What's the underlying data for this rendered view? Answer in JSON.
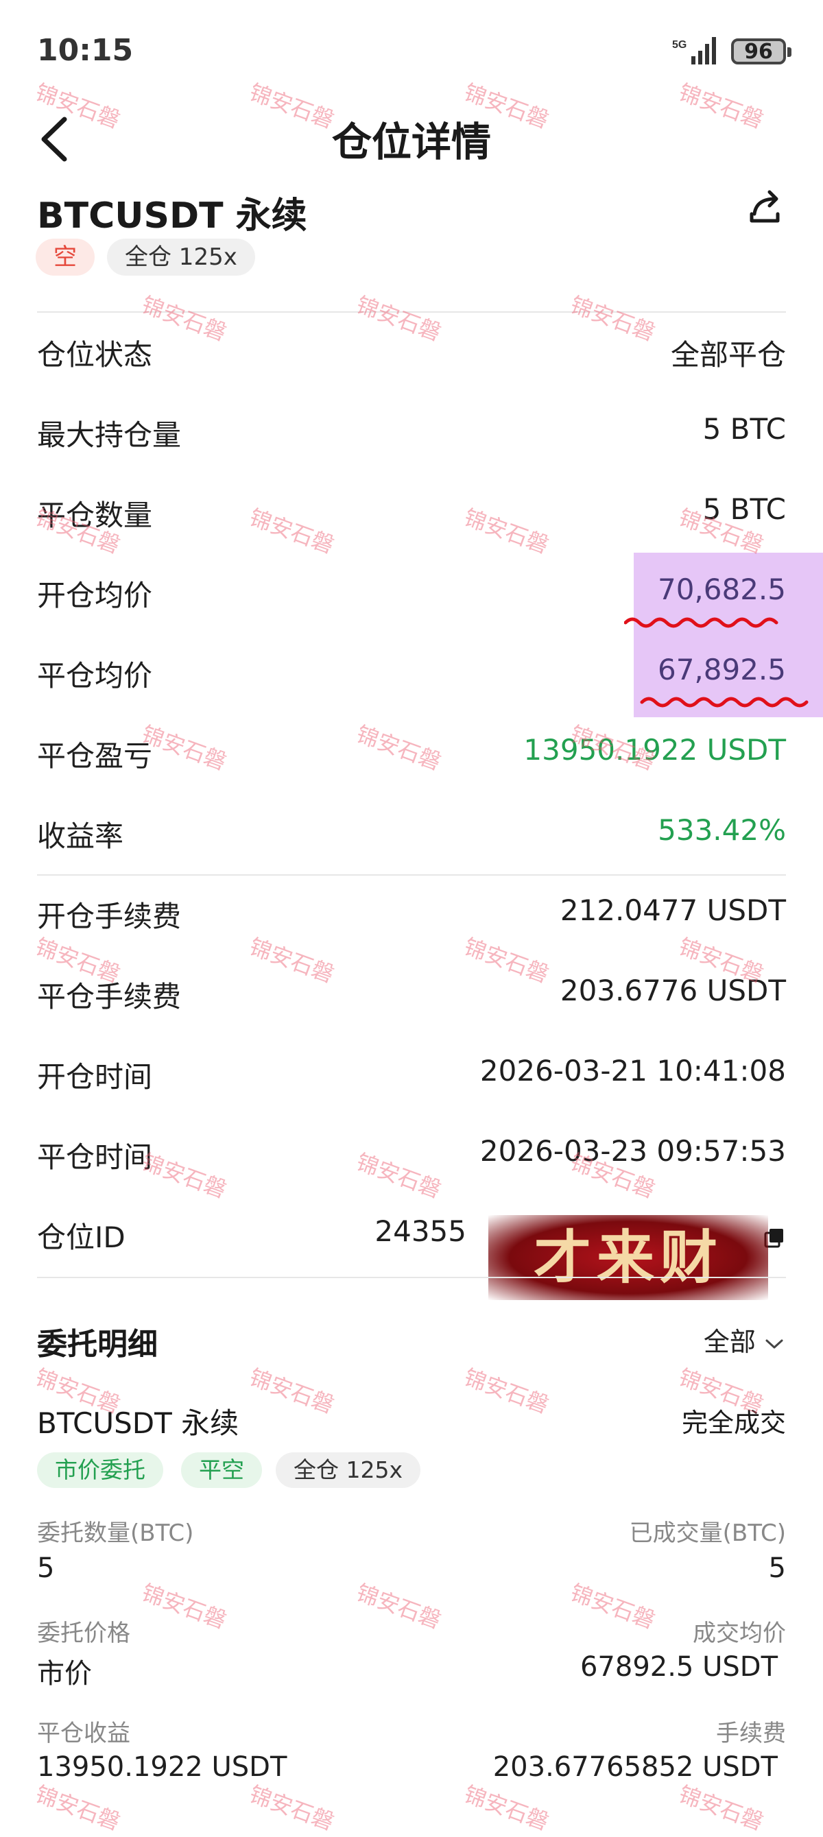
{
  "status_bar": {
    "time": "10:15",
    "network": "5G",
    "battery": "96"
  },
  "header": {
    "title": "仓位详情"
  },
  "position": {
    "symbol": "BTCUSDT 永续",
    "side_tag": "空",
    "margin_tag": "全仓 125x",
    "rows_a": [
      {
        "label": "仓位状态",
        "value": "全部平仓"
      },
      {
        "label": "最大持仓量",
        "value": "5 BTC"
      },
      {
        "label": "平仓数量",
        "value": "5 BTC"
      },
      {
        "label": "开仓均价",
        "value": "70,682.5"
      },
      {
        "label": "平仓均价",
        "value": "67,892.5"
      },
      {
        "label": "平仓盈亏",
        "value": "13950.1922 USDT"
      },
      {
        "label": "收益率",
        "value": "533.42%"
      }
    ],
    "rows_b": [
      {
        "label": "开仓手续费",
        "value": "212.0477 USDT"
      },
      {
        "label": "平仓手续费",
        "value": "203.6776 USDT"
      },
      {
        "label": "开仓时间",
        "value": "2026-03-21 10:41:08"
      },
      {
        "label": "平仓时间",
        "value": "2026-03-23 09:57:53"
      },
      {
        "label": "仓位ID",
        "value": "24355"
      }
    ],
    "sticker_text": "才来财"
  },
  "orders": {
    "section_title": "委托明细",
    "filter_label": "全部",
    "item": {
      "symbol": "BTCUSDT 永续",
      "status": "完全成交",
      "tags": [
        "市价委托",
        "平空",
        "全仓 125x"
      ],
      "qty_label": "委托数量(BTC)",
      "qty_value": "5",
      "filled_label": "已成交量(BTC)",
      "filled_value": "5",
      "price_label": "委托价格",
      "price_value": "市价",
      "avg_label": "成交均价",
      "avg_value": "67892.5 USDT",
      "pnl_label": "平仓收益",
      "pnl_value": "13950.1922 USDT",
      "fee_label": "手续费",
      "fee_value": "203.67765852 USDT"
    }
  },
  "watermark_text": "锦安石磐",
  "colors": {
    "profit": "#23a050",
    "short": "#e5483b",
    "highlight": "#e6c6f7",
    "annotation": "#e0101a"
  },
  "icons": [
    "back-arrow-icon",
    "share-icon",
    "copy-icon",
    "chevron-down-icon",
    "signal-icon",
    "battery-icon"
  ]
}
